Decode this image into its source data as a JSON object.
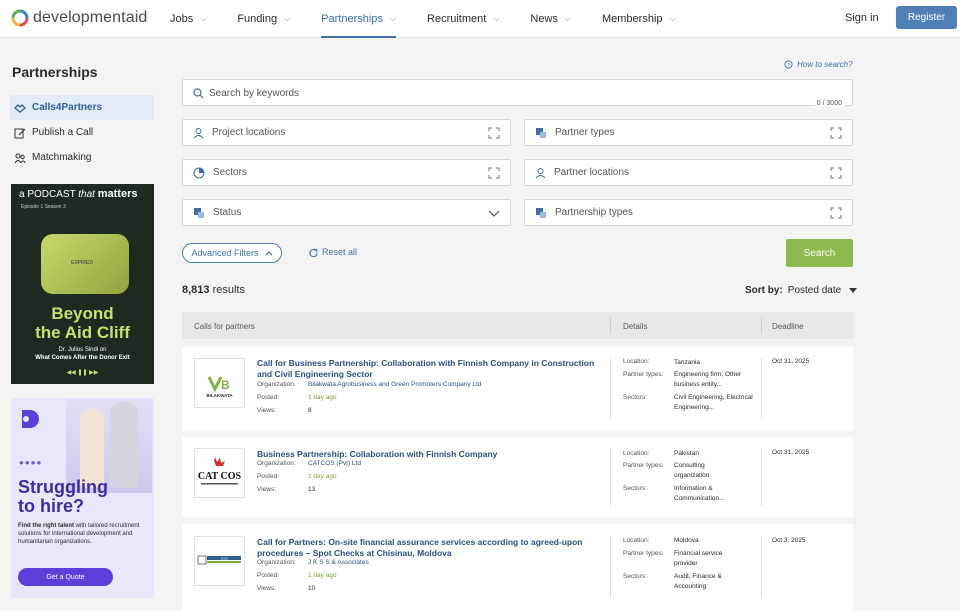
{
  "header": {
    "logo_text": "developmentaid",
    "nav": [
      {
        "label": "Jobs"
      },
      {
        "label": "Funding"
      },
      {
        "label": "Partnerships"
      },
      {
        "label": "Recruitment"
      },
      {
        "label": "News"
      },
      {
        "label": "Membership"
      }
    ],
    "signin": "Sign in",
    "register": "Register",
    "active_color": "#3f6ea8"
  },
  "sidebar": {
    "title": "Partnerships",
    "items": [
      {
        "label": "Calls4Partners",
        "icon": "handshake-icon"
      },
      {
        "label": "Publish a Call",
        "icon": "edit-icon"
      },
      {
        "label": "Matchmaking",
        "icon": "people-icon"
      }
    ]
  },
  "ads": {
    "podcast": {
      "top_line_a": "a PODCAST",
      "top_line_b": "that",
      "top_line_c": "matters",
      "episode": "Episode 1   Season 3",
      "tag_text": "EXPIRED",
      "headline1": "Beyond",
      "headline2": "the Aid Cliff",
      "host": "Dr. Julius Sindi on",
      "subtitle": "What Comes After the Donor Exit"
    },
    "hire": {
      "dots": "●●●●",
      "headline1": "Struggling",
      "headline2": "to hire?",
      "text_bold": "Find the right talent",
      "text": " with tailored recruitment solutions for international development and humanitarian organizations.",
      "button": "Get a Quote"
    }
  },
  "main": {
    "how_to_search": "How to search?",
    "search": {
      "placeholder": "Search by keywords",
      "value": "",
      "counter": "0 / 3000"
    },
    "filters": [
      {
        "label": "Project locations",
        "icon": "location-pin-icon"
      },
      {
        "label": "Partner types",
        "icon": "partner-types-icon"
      },
      {
        "label": "Sectors",
        "icon": "pie-chart-icon"
      },
      {
        "label": "Partner locations",
        "icon": "location-pin-icon"
      },
      {
        "label": "Status",
        "icon": "status-icon"
      },
      {
        "label": "Partnership types",
        "icon": "partnership-types-icon"
      }
    ],
    "advanced_filters": "Advanced Filters",
    "reset_all": "Reset all",
    "search_button": "Search",
    "results_count": "8,813",
    "results_label": "results",
    "sort_label": "Sort by:",
    "sort_value": "Posted date",
    "columns": {
      "calls": "Calls for partners",
      "details": "Details",
      "deadline": "Deadline"
    },
    "labels": {
      "organization": "Organization:",
      "posted": "Posted:",
      "views": "Views:",
      "location": "Location:",
      "partner_types": "Partner types:",
      "sectors": "Sectors:"
    },
    "rows": [
      {
        "title": "Call for Business Partnership: Collaboration with Finnish Company in Construction and Civil Engineering Sector",
        "organization": "Bilakwata Agrobusiness and Green Promoters Company Ltd",
        "posted": "1 day ago",
        "views": "8",
        "location": "Tanzania",
        "partner_types": "Engineering firm, Other business entity...",
        "sectors": "Civil Engineering, Electrical Engineering...",
        "deadline": "Oct 31, 2025",
        "logo_text": "BILAKWATA"
      },
      {
        "title": "Business Partnership: Collaboration with Finnish Company",
        "organization": "CATCOS (Pvt) Ltd",
        "posted": "1 day ago",
        "views": "13",
        "location": "Pakistan",
        "partner_types": "Consulting organization",
        "sectors": "Information & Communication...",
        "deadline": "Oct 31, 2025",
        "logo_text": "CAT COS"
      },
      {
        "title": "Call for Partners: On-site financial assurance services according to agreed-upon procedures – Spot Checks at Chisinau, Moldova",
        "organization": "J K S S & Associates",
        "posted": "1 day ago",
        "views": "10",
        "location": "Moldova",
        "partner_types": "Financial service provider",
        "sectors": "Audit, Finance & Accounting",
        "deadline": "Oct 3, 2025",
        "logo_text": "JKSS"
      }
    ]
  }
}
